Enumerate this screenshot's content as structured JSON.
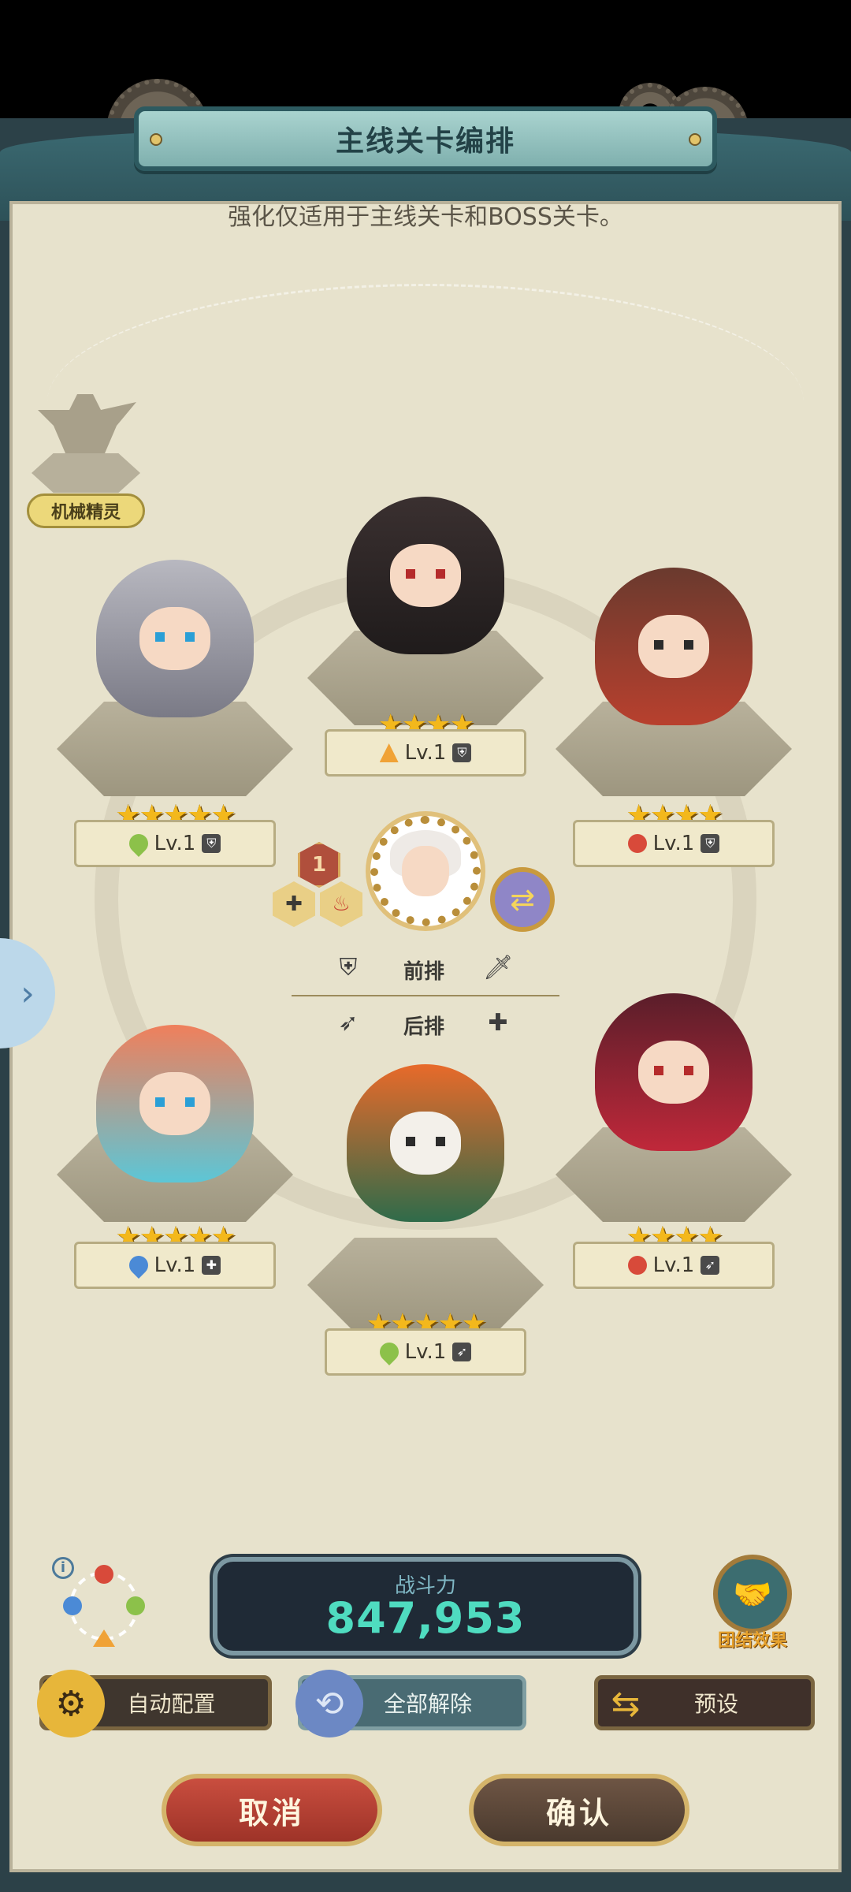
{
  "header": {
    "title": "主线关卡编排",
    "subtitle": "强化仅适用于主线关卡和BOSS关卡。"
  },
  "spirit": {
    "label": "机械精灵"
  },
  "slots": [
    {
      "stars": "★★★★★",
      "level": "Lv.1",
      "element": "grass",
      "role": "shield"
    },
    {
      "stars": "★★★★",
      "level": "Lv.1",
      "element": "earth",
      "role": "shield"
    },
    {
      "stars": "★★★★",
      "level": "Lv.1",
      "element": "fire",
      "role": "shield"
    },
    {
      "stars": "★★★★★",
      "level": "Lv.1",
      "element": "water",
      "role": "heal"
    },
    {
      "stars": "★★★★★",
      "level": "Lv.1",
      "element": "grass",
      "role": "arrow"
    },
    {
      "stars": "★★★★",
      "level": "Lv.1",
      "element": "fire",
      "role": "arrow"
    }
  ],
  "formation": {
    "leader_badge": "1",
    "front_label": "前排",
    "back_label": "后排"
  },
  "bottom": {
    "power_label": "战斗力",
    "power_value": "847,953",
    "unity_label": "团结效果",
    "auto_label": "自动配置",
    "clear_label": "全部解除",
    "preset_label": "预设",
    "cancel_label": "取消",
    "confirm_label": "确认"
  },
  "icons": {
    "info": "info-icon",
    "unity": "handshake-icon",
    "swap": "swap-icon",
    "side": "chevron-right-icon"
  },
  "colors": {
    "panel_bg": "#e7e2cc",
    "frame": "#2c4148",
    "power_value": "#4fdcc0",
    "star": "#f3b81c",
    "cancel": "#c94e3f"
  }
}
